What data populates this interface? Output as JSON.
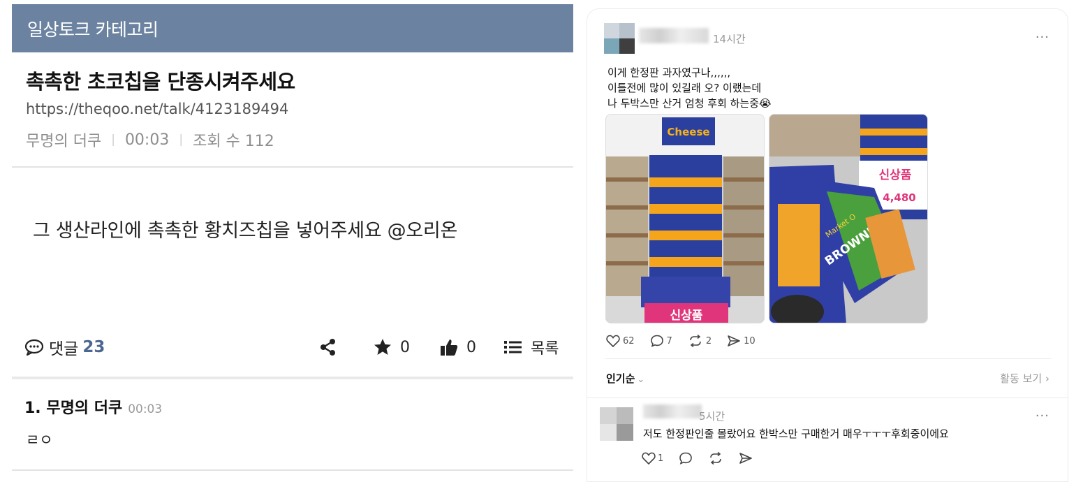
{
  "post": {
    "category": "일상토크 카테고리",
    "title": "촉촉한 초코칩을 단종시켜주세요",
    "url": "https://theqoo.net/talk/4123189494",
    "author": "무명의 더쿠",
    "time": "00:03",
    "views": "조회 수 112",
    "body": "그 생산라인에 촉촉한 황치즈칩을 넣어주세요 @오리온",
    "comment_label": "댓글",
    "comment_count": "23",
    "star_count": "0",
    "like_count": "0",
    "list_label": "목록"
  },
  "comment": {
    "author": "1. 무명의 더쿠",
    "time": "00:03",
    "text": "ㄹㅇ"
  },
  "thread": {
    "time": "14시간",
    "more": "···",
    "lines": [
      "이게 한정판 과자였구나,,,,,,",
      "이틀전에 많이 있길래 오? 이랬는데",
      "나 두박스만 산거 엄청 후회 하는중😭"
    ],
    "likes": "62",
    "comments": "7",
    "reposts": "2",
    "shares": "10",
    "sort_label": "인기순",
    "activity_label": "활동 보기 ›",
    "photo1": {
      "sign": "신상품",
      "brand": "Cheese"
    },
    "photo2": {
      "sign": "신상품",
      "price": "4,480",
      "brand": "BROWNIE",
      "sub": "Market O"
    },
    "reply": {
      "time": "5시간",
      "text": "저도 한정판인줄 몰랐어요 한박스만 구매한거 매우ㅜㅜㅜ후회중이에요",
      "likes": "1"
    }
  },
  "colors": {
    "category_bar": "#6b82a0",
    "comment_count": "#4a6691"
  }
}
